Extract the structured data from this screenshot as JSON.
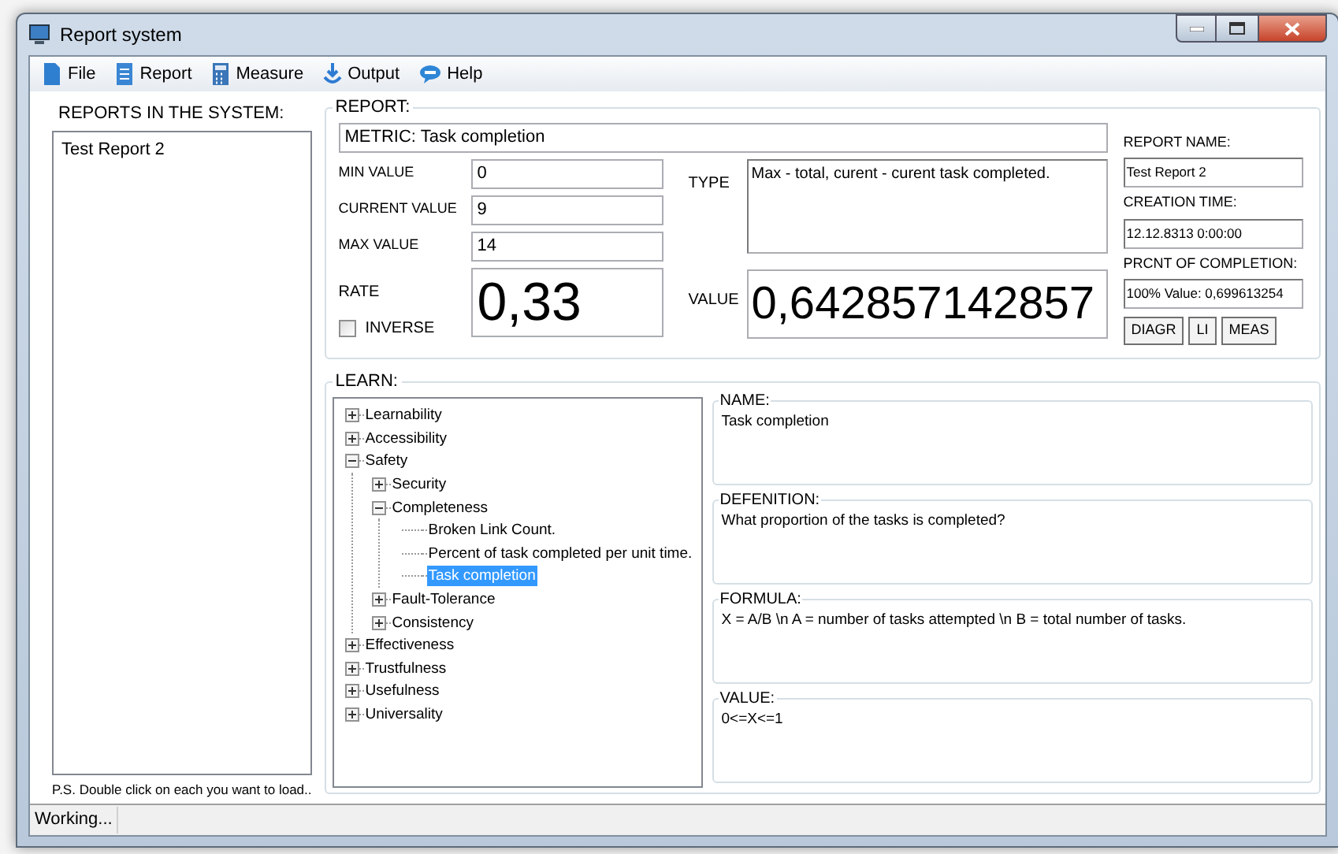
{
  "window": {
    "title": "Report system"
  },
  "menu": [
    {
      "label": "File"
    },
    {
      "label": "Report"
    },
    {
      "label": "Measure"
    },
    {
      "label": "Output"
    },
    {
      "label": "Help"
    }
  ],
  "reports_panel": {
    "title": "REPORTS IN THE SYSTEM:",
    "items": [
      {
        "label": "Test Report 2",
        "selected": false
      }
    ],
    "hint": "P.S. Double click on each you want to load.."
  },
  "report": {
    "title": "REPORT:",
    "metric": "METRIC: Task completion",
    "fields": [
      {
        "label": "MIN VALUE",
        "value": "0"
      },
      {
        "label": "CURRENT VALUE",
        "value": "9"
      },
      {
        "label": "MAX VALUE",
        "value": "14"
      }
    ],
    "rate": {
      "label": "RATE",
      "value": "0,33"
    },
    "inverse": {
      "label": "INVERSE",
      "checked": false
    },
    "type": {
      "label": "TYPE",
      "value": "Max - total, curent - curent task completed."
    },
    "value": {
      "label": "VALUE",
      "value": "0,642857142857"
    },
    "side_fields": [
      {
        "label": "REPORT NAME:",
        "value": "Test Report 2"
      },
      {
        "label": "CREATION TIME:",
        "value": "12.12.8313 0:00:00"
      },
      {
        "label": "PRCNT OF COMPLETION:",
        "value": "100% Value: 0,699613254"
      }
    ],
    "buttons": [
      "DIAGR",
      "LI",
      "MEAS"
    ]
  },
  "learn": {
    "title": "LEARN:",
    "tree": [
      {
        "label": "Learnability",
        "expanded": false,
        "selected": false
      },
      {
        "label": "Accessibility",
        "expanded": false,
        "selected": false
      },
      {
        "label": "Safety",
        "expanded": true,
        "selected": false,
        "children": [
          {
            "label": "Security",
            "expanded": false,
            "selected": false
          },
          {
            "label": "Completeness",
            "expanded": true,
            "selected": false,
            "children": [
              {
                "label": "Broken Link Count.",
                "selected": false
              },
              {
                "label": "Percent of task completed per unit time.",
                "selected": false
              },
              {
                "label": "Task completion",
                "selected": true
              }
            ]
          },
          {
            "label": "Fault-Tolerance",
            "expanded": false,
            "selected": false
          },
          {
            "label": "Consistency",
            "expanded": false,
            "selected": false
          }
        ]
      },
      {
        "label": "Effectiveness",
        "expanded": false,
        "selected": false
      },
      {
        "label": "Trustfulness",
        "expanded": false,
        "selected": false
      },
      {
        "label": "Usefulness",
        "expanded": false,
        "selected": false
      },
      {
        "label": "Universality",
        "expanded": false,
        "selected": false
      }
    ],
    "details": [
      {
        "label": "NAME:",
        "text": "Task completion"
      },
      {
        "label": "DEFENITION:",
        "text": "What proportion of the tasks is completed?"
      },
      {
        "label": "FORMULA:",
        "text": "X = A/B \\n A = number of tasks attempted \\n B = total number of tasks."
      },
      {
        "label": "VALUE:",
        "text": "0<=X<=1"
      }
    ]
  },
  "status_bar": {
    "text": "Working..."
  }
}
